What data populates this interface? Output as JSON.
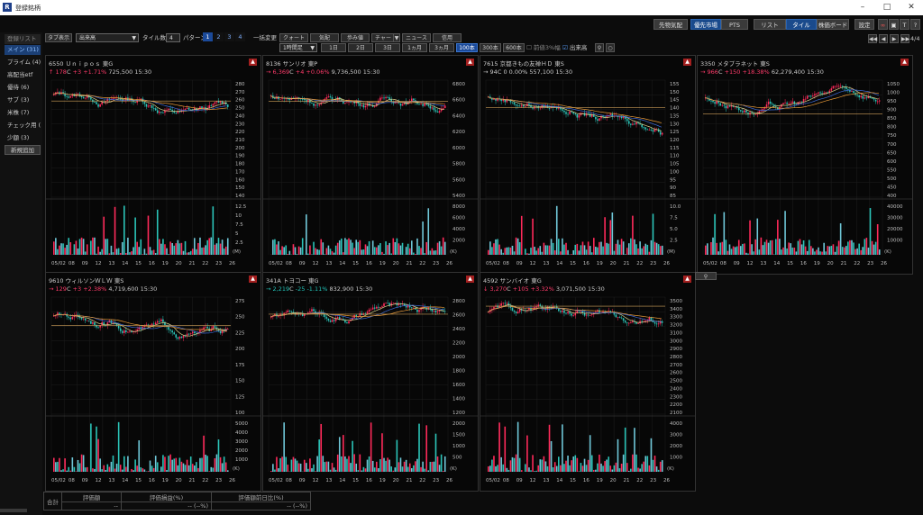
{
  "window": {
    "title": "登録銘柄",
    "app_icon_label": "R"
  },
  "topbar": {
    "buttons": [
      {
        "label": "先物気配",
        "active": false
      },
      {
        "label": "優先市場",
        "active": true
      },
      {
        "label": "PTS",
        "active": false
      },
      {
        "label": "リスト",
        "active": false
      },
      {
        "label": "タイル",
        "active": true
      },
      {
        "label": "株価ボード",
        "active": false
      },
      {
        "label": "設定",
        "active": false
      }
    ]
  },
  "sidebar": {
    "header": "登録リスト",
    "items": [
      {
        "label": "メイン (31)",
        "active": true
      },
      {
        "label": "プライム (4)",
        "active": false
      },
      {
        "label": "高配当etf",
        "active": false
      },
      {
        "label": "優待 (6)",
        "active": false
      },
      {
        "label": "サブ (3)",
        "active": false
      },
      {
        "label": "米株 (7)",
        "active": false
      },
      {
        "label": "チェック用 (",
        "active": false
      },
      {
        "label": "少額 (3)",
        "active": false
      }
    ],
    "add_label": "新規追加"
  },
  "controls": {
    "tab_display": "タブ表示",
    "display_item": "出来高",
    "tile_count_label": "タイル数",
    "tile_count": "4",
    "pattern_label": "パターン",
    "patterns": [
      "1",
      "2",
      "3",
      "4"
    ],
    "bulk_change": "一括変更",
    "bulk_buttons": [
      "クォート",
      "気配",
      "歩み値",
      "チャート",
      "ニュース",
      "信用"
    ],
    "timeframe": "1時間足",
    "periods": [
      "1日",
      "2日",
      "3日",
      "1ヵ月",
      "3ヵ月",
      "100本",
      "300本",
      "600本"
    ],
    "selected_period": "100本",
    "chk_prev_close": "前値3%幅",
    "chk_volume": "出来高",
    "page_label": "4/4"
  },
  "panels": [
    {
      "code": "6550",
      "name": "Ｕｎｉｐｏｓ",
      "market": "東G",
      "arrow": "↑",
      "price": "178",
      "price_suffix": "C",
      "change": "+3 +1.71%",
      "volume": "725,500",
      "time": "15:30",
      "dir": "up",
      "price_ticks": [
        "280",
        "270",
        "260",
        "250",
        "240",
        "230",
        "220",
        "210",
        "200",
        "190",
        "180",
        "170",
        "160",
        "150",
        "140"
      ],
      "vol_ticks": [
        "12.5",
        "10",
        "7.5",
        "5",
        "2.5"
      ],
      "vol_unit": "(M)"
    },
    {
      "code": "8136",
      "name": "サンリオ",
      "market": "東P",
      "arrow": "→",
      "price": "6,369",
      "price_suffix": "C",
      "change": "+4 +0.06%",
      "volume": "9,736,500",
      "time": "15:30",
      "dir": "up",
      "price_ticks": [
        "6800",
        "6600",
        "6400",
        "6200",
        "6000",
        "5800",
        "5600",
        "5400"
      ],
      "vol_ticks": [
        "8000",
        "6000",
        "4000",
        "2000"
      ],
      "vol_unit": "(K)"
    },
    {
      "code": "7615",
      "name": "京都きもの友禅ＨＤ",
      "market": "東S",
      "arrow": "→",
      "price": "94",
      "price_suffix": "C",
      "change": "0 0.00%",
      "volume": "557,100",
      "time": "15:30",
      "dir": "fl",
      "price_ticks": [
        "155",
        "150",
        "145",
        "140",
        "135",
        "130",
        "125",
        "120",
        "115",
        "110",
        "105",
        "100",
        "95",
        "90",
        "85"
      ],
      "vol_ticks": [
        "10.0",
        "7.5",
        "5.0",
        "2.5"
      ],
      "vol_unit": "(M)"
    },
    {
      "code": "3350",
      "name": "メタプラネット",
      "market": "東S",
      "arrow": "→",
      "price": "966",
      "price_suffix": "C",
      "change": "+150 +18.38%",
      "volume": "62,279,400",
      "time": "15:30",
      "dir": "up",
      "price_ticks": [
        "1050",
        "1000",
        "950",
        "900",
        "850",
        "800",
        "750",
        "700",
        "650",
        "600",
        "550",
        "500",
        "450",
        "400"
      ],
      "vol_ticks": [
        "40000",
        "30000",
        "20000",
        "10000"
      ],
      "vol_unit": "(K)"
    },
    {
      "code": "9610",
      "name": "ウィルソンＷＬＷ",
      "market": "東S",
      "arrow": "→",
      "price": "129",
      "price_suffix": "C",
      "change": "+3 +2.38%",
      "volume": "4,719,600",
      "time": "15:30",
      "dir": "up",
      "price_ticks": [
        "275",
        "250",
        "225",
        "200",
        "175",
        "150",
        "125",
        "100"
      ],
      "vol_ticks": [
        "5000",
        "4000",
        "3000",
        "2000",
        "1000"
      ],
      "vol_unit": "(K)"
    },
    {
      "code": "341A",
      "name": "トヨコー",
      "market": "東G",
      "arrow": "→",
      "price": "2,219",
      "price_suffix": "C",
      "change": "-25 -1.11%",
      "volume": "832,900",
      "time": "15:30",
      "dir": "dn",
      "price_ticks": [
        "2800",
        "2600",
        "2400",
        "2200",
        "2000",
        "1800",
        "1600",
        "1400",
        "1200"
      ],
      "vol_ticks": [
        "2000",
        "1500",
        "1000",
        "500"
      ],
      "vol_unit": "(K)"
    },
    {
      "code": "4592",
      "name": "サンバイオ",
      "market": "東G",
      "arrow": "↓",
      "price": "3,270",
      "price_suffix": "C",
      "change": "+105 +3.32%",
      "volume": "3,071,500",
      "time": "15:30",
      "dir": "up",
      "price_ticks": [
        "3500",
        "3400",
        "3300",
        "3200",
        "3100",
        "3000",
        "2900",
        "2800",
        "2700",
        "2600",
        "2500",
        "2400",
        "2300",
        "2200",
        "2100"
      ],
      "vol_ticks": [
        "4000",
        "3000",
        "2000",
        "1000"
      ],
      "vol_unit": "(K)"
    }
  ],
  "x_labels": [
    "05/02",
    "08",
    "09",
    "12",
    "13",
    "14",
    "15",
    "16",
    "19",
    "20",
    "21",
    "22",
    "23",
    "26"
  ],
  "summary": {
    "label": "合計",
    "col1": "評価額",
    "col2": "評価損益(%)",
    "col3": "評価額前日比(%)",
    "v1": "--",
    "v2": "--  (--%)",
    "v3": "--  (--%)"
  },
  "colors": {
    "up": "#ff2a5a",
    "down": "#2bc4b8",
    "ma_yellow": "#d8d08a",
    "ma_blue": "#3d6ad8",
    "ma_orange": "#e89a38",
    "ref": "#d0a15a"
  }
}
